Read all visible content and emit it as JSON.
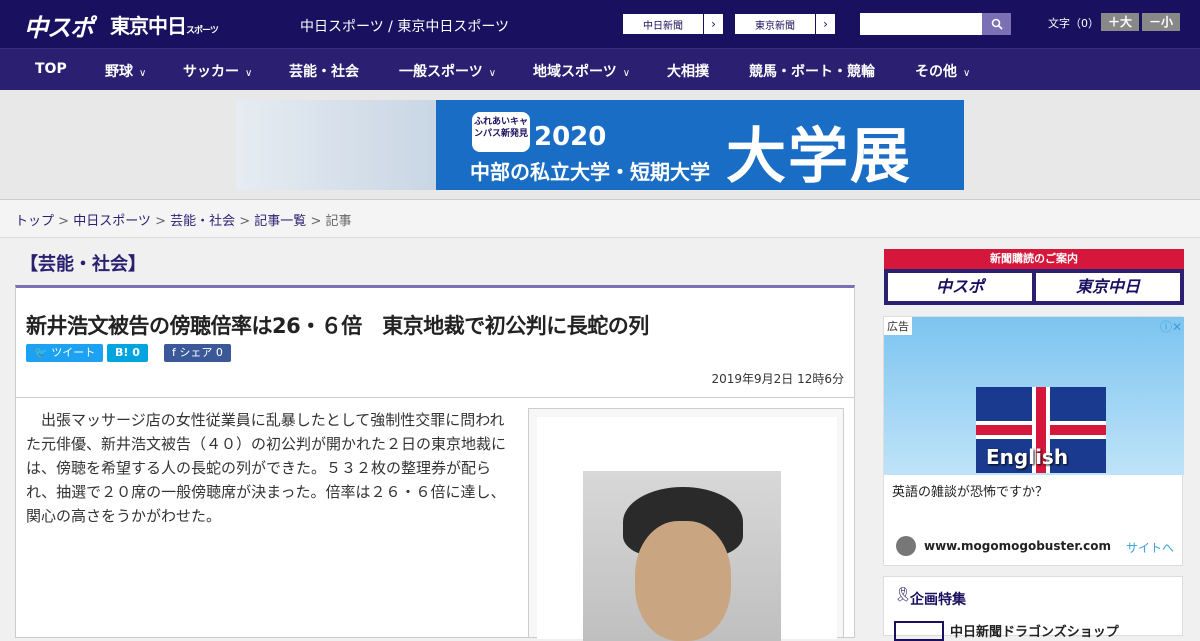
{
  "header": {
    "logo_main": "中スポ",
    "logo_tokyo": "東京中日",
    "logo_tokyo_sub": "スポーツ",
    "site_title": "中日スポーツ / 東京中日スポーツ",
    "ext_links": [
      "中日新聞",
      "東京新聞"
    ],
    "search_placeholder": "",
    "font_size_label": "文字（0）",
    "font_plus": "＋大",
    "font_minus": "－小"
  },
  "nav": {
    "items": [
      {
        "label": "TOP",
        "dropdown": false
      },
      {
        "label": "野球",
        "dropdown": true
      },
      {
        "label": "サッカー",
        "dropdown": true
      },
      {
        "label": "芸能・社会",
        "dropdown": false
      },
      {
        "label": "一般スポーツ",
        "dropdown": true
      },
      {
        "label": "地域スポーツ",
        "dropdown": true
      },
      {
        "label": "大相撲",
        "dropdown": false
      },
      {
        "label": "競馬・ボート・競輪",
        "dropdown": false
      },
      {
        "label": "その他",
        "dropdown": true
      }
    ]
  },
  "banner": {
    "badge": "ふれあいキャンパス新発見",
    "year": "2020",
    "subtitle": "中部の私立大学・短期大学",
    "big_text": "大学展"
  },
  "breadcrumb": {
    "items": [
      "トップ",
      "中日スポーツ",
      "芸能・社会",
      "記事一覧"
    ],
    "current": "記事",
    "separator": " > "
  },
  "article": {
    "category": "【芸能・社会】",
    "headline": "新井浩文被告の傍聴倍率は26・６倍　東京地裁で初公判に長蛇の列",
    "share": {
      "tweet": "ツイート",
      "hatena": "B! 0",
      "facebook": "シェア 0"
    },
    "date": "2019年9月2日 12時6分",
    "body": "出張マッサージ店の女性従業員に乱暴したとして強制性交罪に問われた元俳優、新井浩文被告（４０）の初公判が開かれた２日の東京地裁には、傍聴を希望する人の長蛇の列ができた。５３２枚の整理券が配られ、抽選で２０席の一般傍聴席が決まった。倍率は２６・６倍に達し、関心の高さをうかがわせた。"
  },
  "sidebar": {
    "subscribe": {
      "title": "新聞購読のご案内",
      "logos": [
        "中スポ",
        "東京中日"
      ]
    },
    "ad": {
      "label": "広告",
      "close": "ⓘ✕",
      "flag_text": "English",
      "title": "英語の雑談が恐怖ですか？",
      "site": "www.mogomogobuster.com",
      "link": "サイトへ"
    },
    "feature": {
      "title": "企画特集",
      "item": "中日新聞ドラゴンズショップ"
    }
  },
  "colors": {
    "header_bg": "#1a1060",
    "nav_bg": "#2a1f70",
    "accent": "#7b6fb5",
    "subscribe_red": "#d4173a",
    "twitter": "#1da1f2",
    "hatena": "#00a4de",
    "facebook": "#3b5998"
  }
}
